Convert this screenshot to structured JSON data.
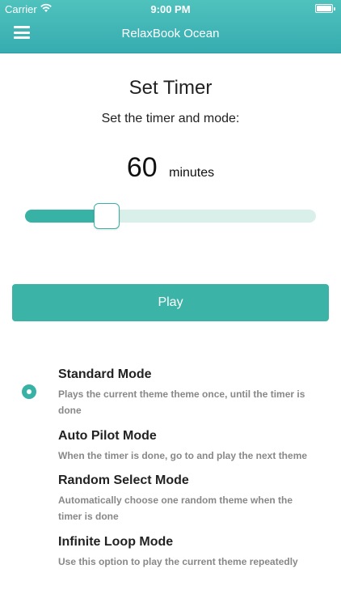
{
  "status_bar": {
    "carrier": "Carrier",
    "time": "9:00 PM"
  },
  "header": {
    "title": "RelaxBook Ocean",
    "menu_icon": "hamburger-menu-icon"
  },
  "timer": {
    "title": "Set Timer",
    "subtitle": "Set the timer and mode:",
    "value": "60",
    "unit": "minutes",
    "slider_fraction": 0.28
  },
  "play_label": "Play",
  "modes": [
    {
      "title": "Standard Mode",
      "description": "Plays the current theme theme once, until the timer is done",
      "selected": true
    },
    {
      "title": "Auto Pilot Mode",
      "description": "When the timer is done, go to and play the next theme",
      "selected": false
    },
    {
      "title": "Random Select Mode",
      "description": "Automatically choose one random theme when the timer is done",
      "selected": false
    },
    {
      "title": "Infinite Loop Mode",
      "description": "Use this option to play the current theme repeatedly",
      "selected": false
    }
  ],
  "colors": {
    "accent": "#3cb3a7",
    "header_top": "#4fc2bd",
    "header_bottom": "#37acb0",
    "track": "#d9efea"
  }
}
